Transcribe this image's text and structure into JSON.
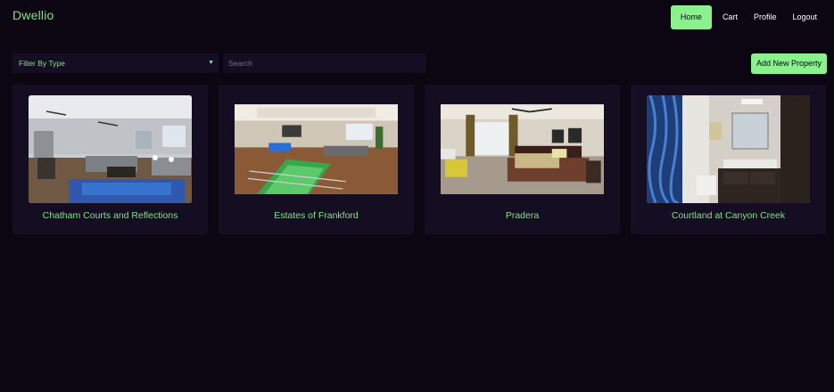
{
  "brand": "Dwellio",
  "nav": {
    "home": "Home",
    "cart": "Cart",
    "profile": "Profile",
    "logout": "Logout"
  },
  "toolbar": {
    "filter_label": "Filter By Type",
    "search_placeholder": "Search",
    "add_label": "Add New Property"
  },
  "properties": [
    {
      "title": "Chatham Courts and Reflections"
    },
    {
      "title": "Estates of Frankford"
    },
    {
      "title": "Pradera"
    },
    {
      "title": "Courtland at Canyon Creek"
    }
  ],
  "colors": {
    "background": "#0b0612",
    "panel": "#150d22",
    "accent": "#8cf08f",
    "accent_text": "#86e08a"
  }
}
